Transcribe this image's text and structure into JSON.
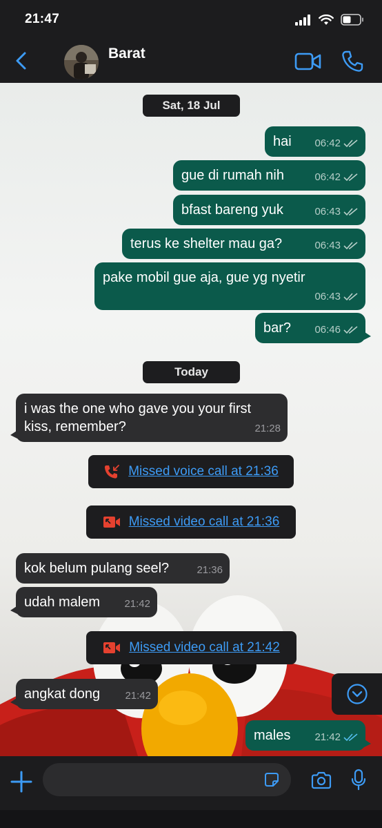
{
  "status_bar": {
    "time": "21:47"
  },
  "header": {
    "contact_name": "Barat"
  },
  "chat": {
    "date_separators": [
      "Sat, 18 Jul",
      "Today"
    ],
    "messages": [
      {
        "text": "hai",
        "time": "06:42"
      },
      {
        "text": "gue di rumah nih",
        "time": "06:42"
      },
      {
        "text": "bfast bareng yuk",
        "time": "06:43"
      },
      {
        "text": "terus ke shelter mau ga?",
        "time": "06:43"
      },
      {
        "text": "pake mobil gue aja, gue yg nyetir",
        "time": "06:43"
      },
      {
        "text": "bar?",
        "time": "06:46"
      },
      {
        "text": "i was the one who gave you your first",
        "text2": "kiss, remember?",
        "time": "21:28"
      },
      {
        "text": "kok belum pulang seel?",
        "time": "21:36"
      },
      {
        "text": "udah malem",
        "time": "21:42"
      },
      {
        "text": "angkat dong",
        "time": "21:42"
      },
      {
        "text": "males",
        "time": "21:42"
      }
    ],
    "calls": [
      {
        "text": "Missed voice call at 21:36",
        "icon": "missed-voice-call-icon"
      },
      {
        "text": "Missed video call at 21:36",
        "icon": "missed-video-call-icon"
      },
      {
        "text": "Missed video call at 21:42",
        "icon": "missed-video-call-icon"
      }
    ]
  },
  "colors": {
    "accent": "#3d9bf5",
    "outgoing_bubble": "#0b5a4b",
    "incoming_bubble": "#2d2d2f",
    "missed_call": "#e5412f",
    "read_ticks": "#53bdeb"
  }
}
